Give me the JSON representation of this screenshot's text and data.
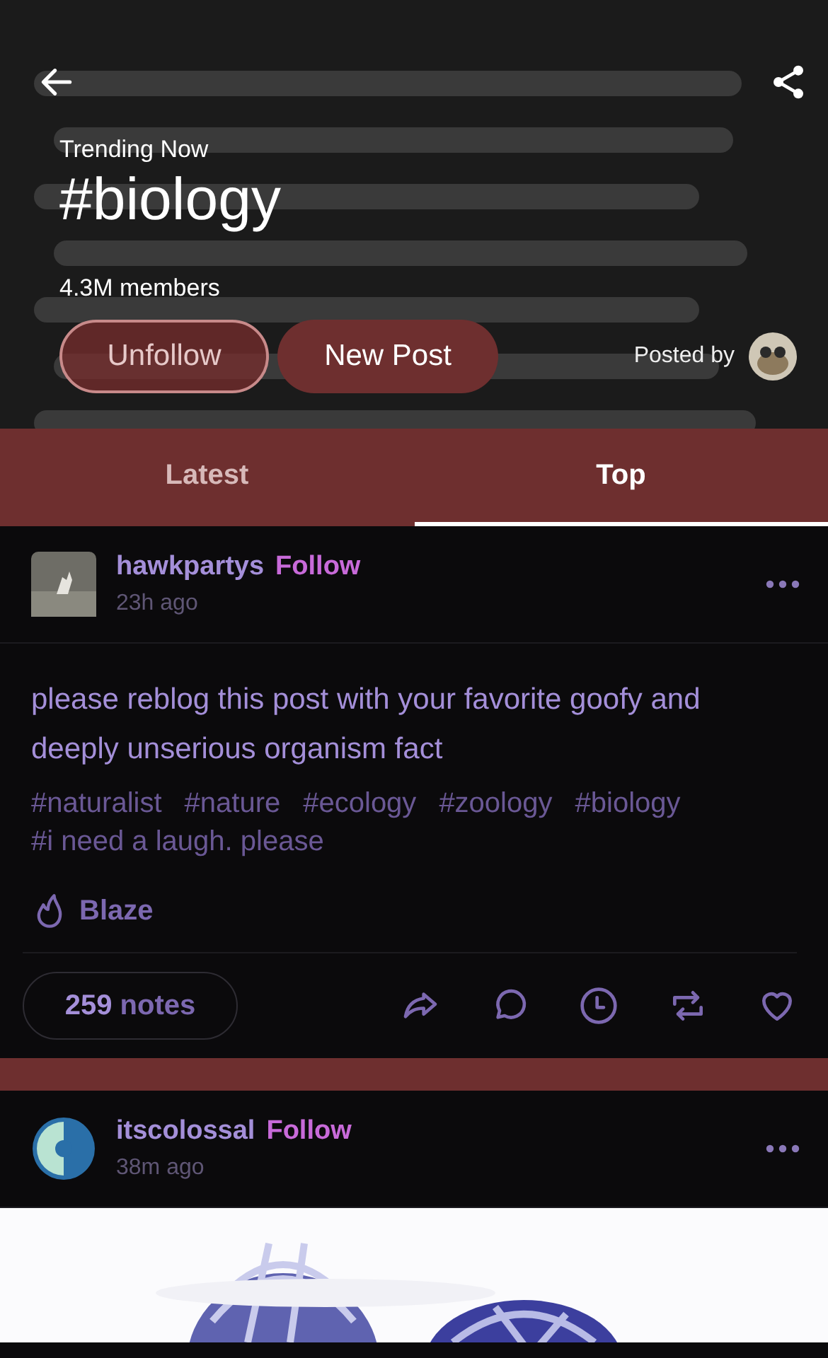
{
  "header": {
    "trending_label": "Trending Now",
    "title": "#biology",
    "members": "4.3M members",
    "buttons": [
      {
        "label": "Unfollow",
        "kind": "outline"
      },
      {
        "label": "New Post",
        "kind": "filled"
      }
    ],
    "posted_by": "Posted by"
  },
  "tabs": [
    {
      "label": "Latest",
      "selected": false
    },
    {
      "label": "Top",
      "selected": true
    }
  ],
  "posts": [
    {
      "username": "hawkpartys",
      "follow": "Follow",
      "time": "23h ago",
      "body": "please reblog this post with your favorite goofy and deeply unserious organism fact",
      "tags": [
        "#naturalist",
        "#nature",
        "#ecology",
        "#zoology",
        "#biology",
        "#i need a laugh. please"
      ],
      "blaze": "Blaze",
      "notes_count": "259",
      "notes_label": "notes"
    },
    {
      "username": "itscolossal",
      "follow": "Follow",
      "time": "38m ago",
      "avatar": {
        "kind": "logo"
      }
    }
  ]
}
